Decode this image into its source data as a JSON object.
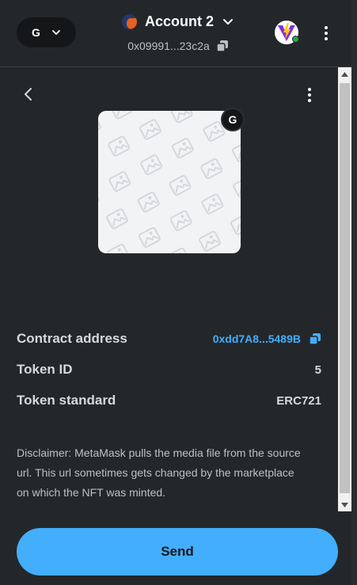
{
  "header": {
    "network_label": "G",
    "account_name": "Account 2",
    "account_address": "0x09991...23c2a"
  },
  "nft": {
    "badge_label": "G"
  },
  "details": {
    "contract_label": "Contract address",
    "contract_value": "0xdd7A8...5489B",
    "token_id_label": "Token ID",
    "token_id_value": "5",
    "standard_label": "Token standard",
    "standard_value": "ERC721"
  },
  "disclaimer": "Disclaimer: MetaMask pulls the media file from the source url. This url sometimes gets changed by the marketplace on which the NFT was minted.",
  "footer": {
    "send_label": "Send"
  },
  "colors": {
    "background": "#24272a",
    "accent": "#43aefc",
    "online": "#28a745"
  },
  "icons": [
    "chevron-down-icon",
    "fox-avatar-icon",
    "copy-icon",
    "site-favicon-icon",
    "kebab-menu-icon",
    "back-arrow-icon",
    "image-placeholder-icon"
  ]
}
